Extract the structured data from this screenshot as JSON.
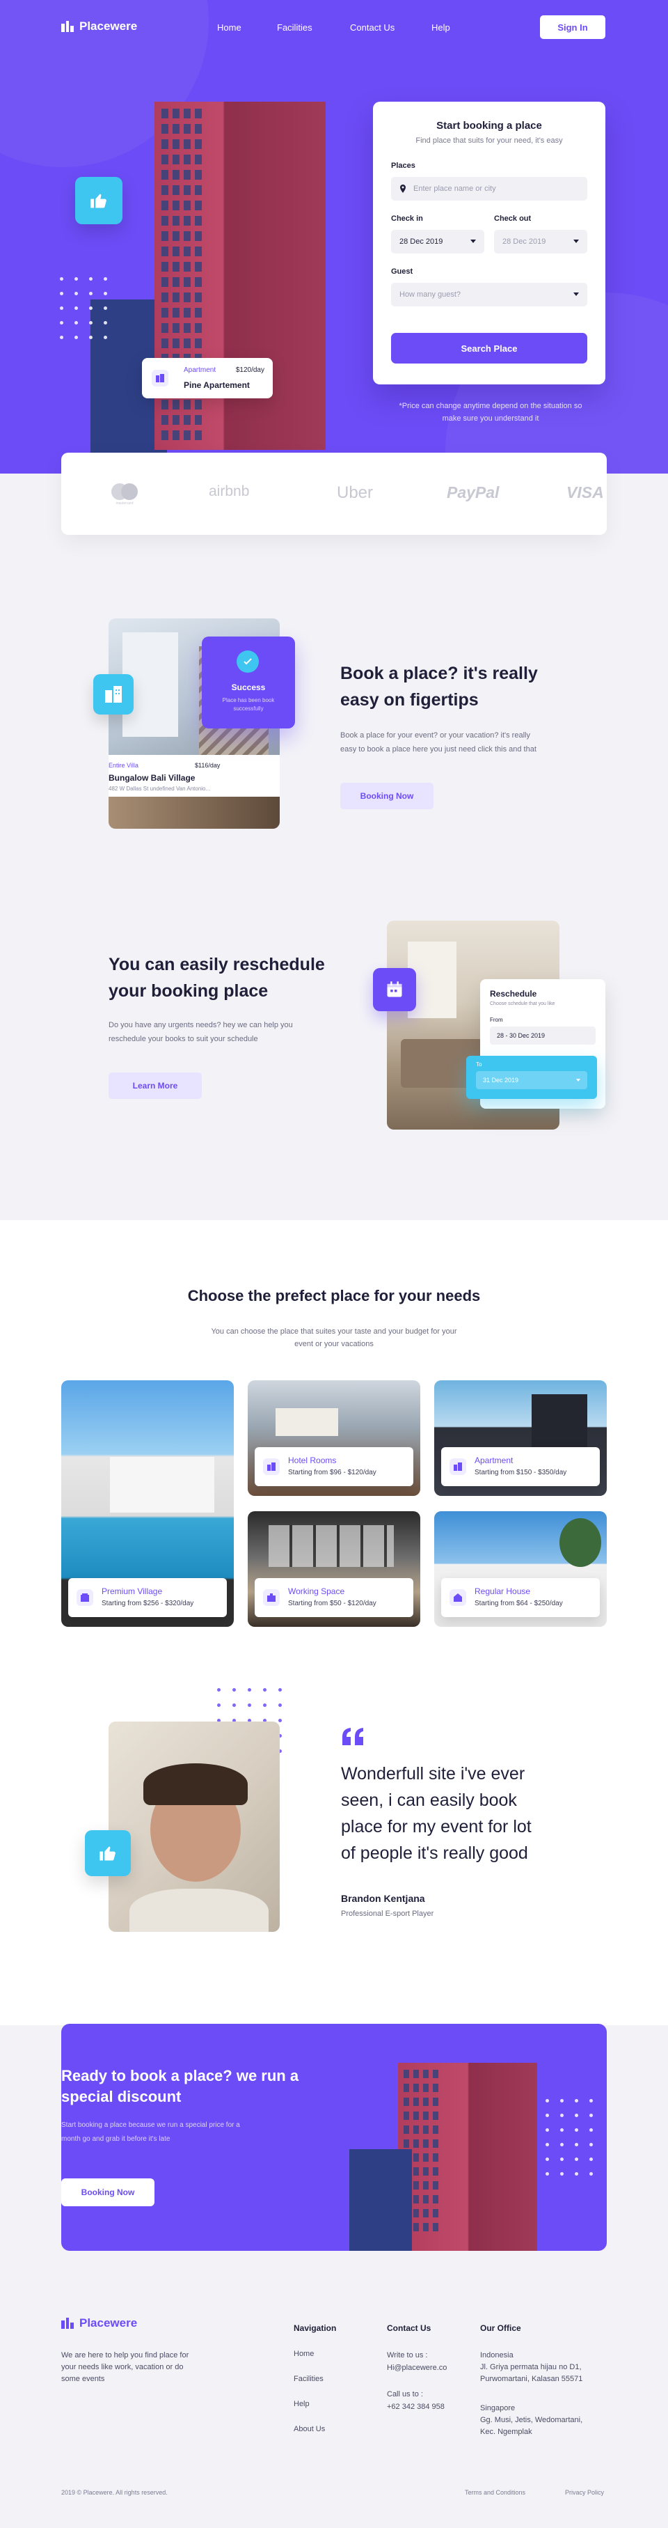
{
  "nav": {
    "brand": "Placewere",
    "links": [
      "Home",
      "Facilities",
      "Contact Us",
      "Help"
    ],
    "signin": "Sign In"
  },
  "hero": {
    "apartment_card": {
      "type": "Apartment",
      "price": "$120/day",
      "name": "Pine Apartement"
    },
    "booking": {
      "title": "Start booking a place",
      "subtitle": "Find place that suits for your need, it's easy",
      "places_label": "Places",
      "places_placeholder": "Enter place name or city",
      "checkin_label": "Check in",
      "checkin_value": "28 Dec 2019",
      "checkout_label": "Check out",
      "checkout_value": "28 Dec 2019",
      "guest_label": "Guest",
      "guest_placeholder": "How many guest?",
      "search_button": "Search Place"
    },
    "note": "*Price can change anytime depend on the situation so make sure you understand it"
  },
  "partners": [
    "mastercard",
    "airbnb",
    "Uber",
    "PayPal",
    "VISA"
  ],
  "feature_book": {
    "success_title": "Success",
    "success_text": "Place has been book successfully",
    "villa_type": "Entire Villa",
    "villa_price": "$116/day",
    "villa_name": "Bungalow Bali Village",
    "villa_address": "482 W Dallas St undefined Van Antonio...",
    "title_line1": "Book a place? it's really",
    "title_line2": "easy on figertips",
    "text_line1": "Book a place for your event? or your vacation? it's really",
    "text_line2": "easy to book a place here you just need click this and that",
    "button": "Booking Now"
  },
  "feature_reschedule": {
    "title_line1": "You can easily reschedule",
    "title_line2": "your booking place",
    "text_line1": "Do you have any urgents needs? hey we can help you",
    "text_line2": "reschedule your books to suit your schedule",
    "button": "Learn More",
    "card_title": "Reschedule",
    "card_sub": "Choose schedule that you like",
    "from_label": "From",
    "from_value": "28 - 30 Dec 2019",
    "to_label": "To",
    "to_value": "31 Dec 2019"
  },
  "places": {
    "title": "Choose the prefect place for your needs",
    "subtitle_line1": "You can choose the place that suites your taste and your budget for your",
    "subtitle_line2": "event or your vacations",
    "items": [
      {
        "name": "Hotel Rooms",
        "price": "Starting from $96 - $120/day"
      },
      {
        "name": "Apartment",
        "price": "Starting from $150 - $350/day"
      },
      {
        "name": "Premium Village",
        "price": "Starting from $256 - $320/day"
      },
      {
        "name": "Working Space",
        "price": "Starting from $50 - $120/day"
      },
      {
        "name": "Regular House",
        "price": "Starting from $64 - $250/day"
      }
    ]
  },
  "testimonial": {
    "line1": "Wonderfull site i've ever",
    "line2": "seen, i can easily book",
    "line3": "place for my event for lot",
    "line4": "of people it's  really good",
    "name": "Brandon Kentjana",
    "role": "Professional E-sport Player"
  },
  "cta": {
    "title_line1": "Ready to book a place? we run a",
    "title_line2": "special discount",
    "text_line1": "Start booking a place because we run a special price for a",
    "text_line2": "month go and grab it before it's late",
    "button": "Booking Now"
  },
  "footer": {
    "brand": "Placewere",
    "about_line1": "We are here to help you find place for",
    "about_line2": "your needs like work, vacation or do",
    "about_line3": "some events",
    "nav_title": "Navigation",
    "nav_links": [
      "Home",
      "Facilities",
      "Help",
      "About Us"
    ],
    "contact_title": "Contact Us",
    "write_label": "Write to us :",
    "email": "Hi@placewere.co",
    "call_label": "Call us to :",
    "phone": "+62 342 384 958",
    "office_title": "Our Office",
    "office1_line1": "Indonesia",
    "office1_line2": "Jl. Griya permata hijau no D1,",
    "office1_line3": "Purwomartani, Kalasan 55571",
    "office2_line1": "Singapore",
    "office2_line2": "Gg. Musi, Jetis, Wedomartani,",
    "office2_line3": "Kec. Ngemplak",
    "copyright": "2019 © Placewere. All rights reserved.",
    "terms": "Terms and Conditions",
    "privacy": "Privacy Policy"
  },
  "colors": {
    "primary": "#6c4cf6",
    "accent": "#3ec5f0",
    "building": "#b13d5e"
  }
}
